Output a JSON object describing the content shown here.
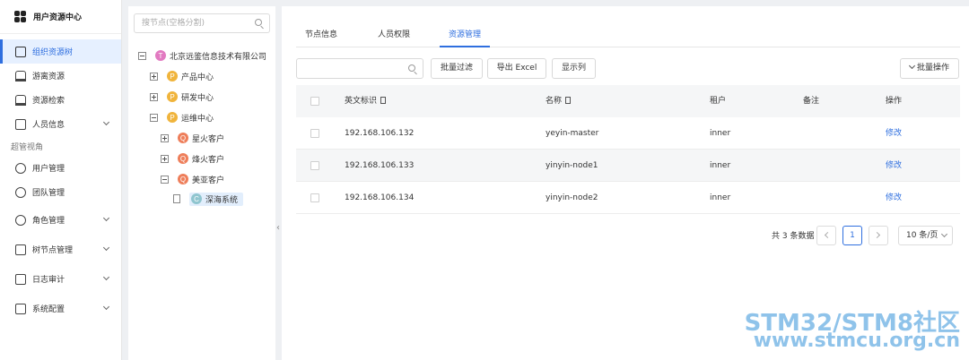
{
  "sidebar": {
    "brand": "用户资源中心",
    "items": [
      {
        "label": "组织资源树",
        "active": true
      },
      {
        "label": "游离资源"
      },
      {
        "label": "资源检索"
      },
      {
        "label": "人员信息",
        "expandable": true
      }
    ],
    "section": "超管视角",
    "admin_items": [
      {
        "label": "用户管理"
      },
      {
        "label": "团队管理"
      },
      {
        "label": "角色管理",
        "expandable": true
      },
      {
        "label": "树节点管理",
        "expandable": true
      },
      {
        "label": "日志审计",
        "expandable": true
      },
      {
        "label": "系统配置",
        "expandable": true
      }
    ]
  },
  "tree": {
    "search_placeholder": "搜节点(空格分割)",
    "nodes": [
      {
        "avatar": "T",
        "label": "北京远鉴信息技术有限公司"
      },
      {
        "avatar": "P",
        "label": "产品中心"
      },
      {
        "avatar": "P",
        "label": "研发中心"
      },
      {
        "avatar": "P",
        "label": "运维中心"
      },
      {
        "avatar": "Q",
        "label": "星火客户"
      },
      {
        "avatar": "Q",
        "label": "烽火客户"
      },
      {
        "avatar": "Q",
        "label": "美亚客户"
      },
      {
        "avatar": "C",
        "label": "深海系统"
      }
    ]
  },
  "tabs": [
    {
      "label": "节点信息"
    },
    {
      "label": "人员权限"
    },
    {
      "label": "资源管理",
      "active": true
    }
  ],
  "toolbar": {
    "search_value": "",
    "batch_filter": "批量过滤",
    "export_excel": "导出 Excel",
    "show_columns": "显示列",
    "batch_ops": "批量操作"
  },
  "table": {
    "headers": {
      "name_en": "英文标识",
      "name": "名称",
      "tenant": "租户",
      "note": "备注",
      "action": "操作"
    },
    "rows": [
      {
        "name_en": "192.168.106.132",
        "name": "yeyin-master",
        "tenant": "inner",
        "note": "",
        "action": "修改"
      },
      {
        "name_en": "192.168.106.133",
        "name": "yinyin-node1",
        "tenant": "inner",
        "note": "",
        "action": "修改"
      },
      {
        "name_en": "192.168.106.134",
        "name": "yinyin-node2",
        "tenant": "inner",
        "note": "",
        "action": "修改"
      }
    ]
  },
  "pager": {
    "total": "共 3 条数据",
    "current": "1",
    "page_size": "10 条/页"
  },
  "watermark": {
    "line1": "STM32/STM8社区",
    "line2": "www.stmcu.org.cn"
  },
  "colors": {
    "accent": "#2f6fdf",
    "watermark": "#8fc3ea"
  }
}
